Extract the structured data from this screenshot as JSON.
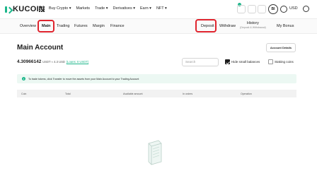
{
  "brand": {
    "name": "KUCOIN"
  },
  "topnav": {
    "items": [
      "Buy Crypto ▾",
      "Markets",
      "Trade ▾",
      "Derivatives ▾",
      "Earn ▾",
      "NFT ▾"
    ],
    "avatar": "BI",
    "currency": "USD"
  },
  "subnav": {
    "overview": "Overview",
    "main": "Main",
    "trading": "Trading",
    "futures": "Futures",
    "margin": "Margin",
    "finance": "Finance",
    "deposit": "Deposit",
    "withdraw": "Withdraw",
    "history": "History",
    "history_sub": "(Deposit & Withdrawal)",
    "bonus": "My Bonus"
  },
  "main": {
    "title": "Main Account",
    "account_details": "Account Details",
    "balance_value": "4.30966142",
    "balance_unit": "USDT ≈ 4.3 USD",
    "loans": "(Loans: 0 USDT)",
    "search_placeholder": "Search",
    "hide_small": "Hide small balances",
    "staking": "Staking coins",
    "info_text": "To trade tokens, click Transfer to move the assets from your Main Account to your Trading Account",
    "columns": [
      "Coin",
      "Total",
      "Available amount",
      "In orders",
      "Operation"
    ]
  },
  "colors": {
    "accent": "#1cb68a",
    "highlight": "#e0242e"
  }
}
